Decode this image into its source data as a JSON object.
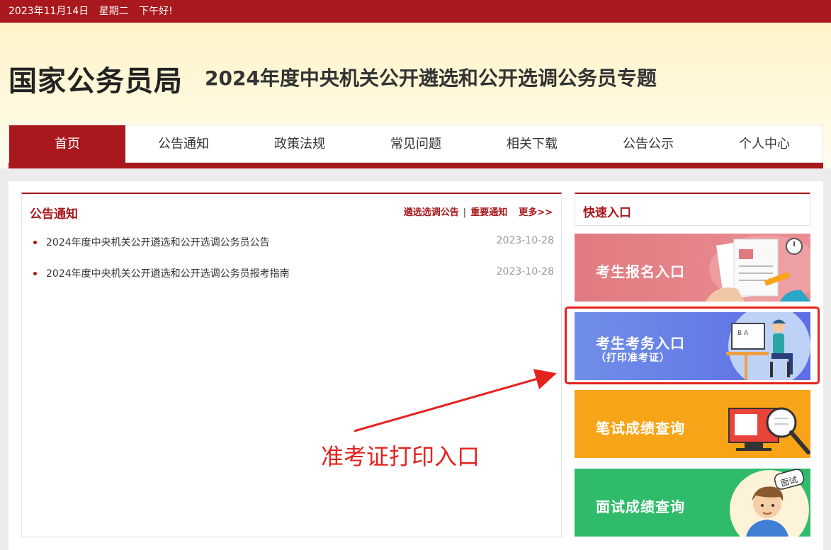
{
  "topbar": {
    "date": "2023年11月14日",
    "weekday": "星期二",
    "greeting": "下午好!"
  },
  "header": {
    "site_name": "国家公务员局",
    "topic_title": "2024年度中央机关公开遴选和公开选调公务员专题"
  },
  "nav": {
    "items": [
      {
        "label": "首页",
        "active": true
      },
      {
        "label": "公告通知"
      },
      {
        "label": "政策法规"
      },
      {
        "label": "常见问题"
      },
      {
        "label": "相关下载"
      },
      {
        "label": "公告公示"
      },
      {
        "label": "个人中心"
      }
    ]
  },
  "notice": {
    "title": "公告通知",
    "link_a": "遴选选调公告",
    "separator": "|",
    "link_b": "重要通知",
    "more": "更多>>",
    "items": [
      {
        "title": "2024年度中央机关公开遴选和公开选调公务员公告",
        "date": "2023-10-28"
      },
      {
        "title": "2024年度中央机关公开遴选和公开选调公务员报考指南",
        "date": "2023-10-28"
      }
    ]
  },
  "quick": {
    "title": "快速入口",
    "banners": [
      {
        "label": "考生报名入口",
        "color": "#e07a80"
      },
      {
        "label": "考生考务入口",
        "sub": "（打印准考证）",
        "color": "#5d6ee6"
      },
      {
        "label": "笔试成绩查询",
        "color": "#f7a419"
      },
      {
        "label": "面试成绩查询",
        "badge": "面试",
        "color": "#2fbb6a"
      }
    ]
  },
  "annotation": {
    "text": "准考证打印入口",
    "color": "#e5221e"
  },
  "colors": {
    "brand": "#a8181c"
  }
}
